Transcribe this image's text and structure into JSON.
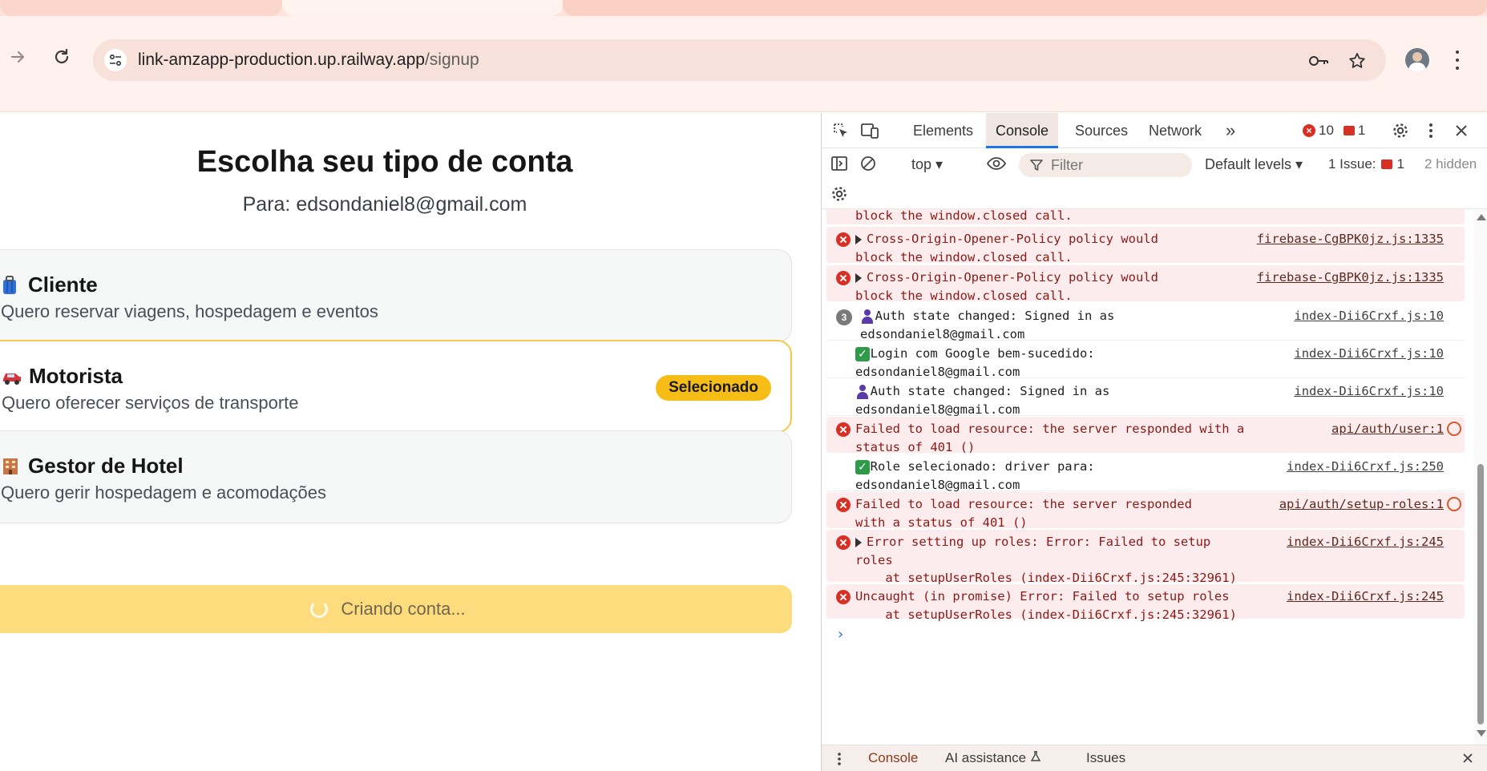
{
  "browser": {
    "url_host": "link-amzapp-production.up.railway.app",
    "url_path": "/signup"
  },
  "page": {
    "title": "Escolha seu tipo de conta",
    "subtitle": "Para: edsondaniel8@gmail.com",
    "cards": [
      {
        "title": "Cliente",
        "description": "Quero reservar viagens, hospedagem e eventos",
        "icon": "luggage-icon"
      },
      {
        "title": "Motorista",
        "description": "Quero oferecer serviços de transporte",
        "icon": "car-icon",
        "badge": "Selecionado"
      },
      {
        "title": "Gestor de Hotel",
        "description": "Quero gerir hospedagem e acomodações",
        "icon": "hotel-icon"
      }
    ],
    "submit_label": "Criando conta..."
  },
  "devtools": {
    "tabs": [
      "Elements",
      "Console",
      "Sources",
      "Network"
    ],
    "active_tab": "Console",
    "more_tabs": "»",
    "error_count": "10",
    "issue_count": "1",
    "context": "top ▾",
    "filter_placeholder": "Filter",
    "levels": "Default levels ▾",
    "issues_label": "1 Issue:",
    "issues_badge": "1",
    "hidden_label": "2 hidden",
    "logs": [
      {
        "type": "error",
        "text": "block the window.closed call.",
        "source": ""
      },
      {
        "type": "error",
        "text": "Cross-Origin-Opener-Policy policy would\nblock the window.closed call.",
        "source": "firebase-CgBPK0jz.js:1335"
      },
      {
        "type": "error",
        "text": "Cross-Origin-Opener-Policy policy would\nblock the window.closed call.",
        "source": "firebase-CgBPK0jz.js:1335"
      },
      {
        "type": "info",
        "repeat": "3",
        "text": "  Auth state changed: Signed in as\nedsondaniel8@gmail.com",
        "source": "index-Dii6Crxf.js:10"
      },
      {
        "type": "info",
        "text": "  Login com Google bem-sucedido:\nedsondaniel8@gmail.com",
        "source": "index-Dii6Crxf.js:10"
      },
      {
        "type": "info",
        "text": "  Auth state changed: Signed in as\nedsondaniel8@gmail.com",
        "source": "index-Dii6Crxf.js:10"
      },
      {
        "type": "error",
        "text": "Failed to load resource: the server responded with a\nstatus of 401 ()",
        "source": "api/auth/user:1"
      },
      {
        "type": "info",
        "text": "  Role selecionado: driver para:\nedsondaniel8@gmail.com",
        "source": "index-Dii6Crxf.js:250"
      },
      {
        "type": "error",
        "text": "Failed to load resource: the server responded\nwith a status of 401 ()",
        "source": "api/auth/setup-roles:1"
      },
      {
        "type": "error",
        "text": "Error setting up roles: Error: Failed to setup\nroles\n    at setupUserRoles (index-Dii6Crxf.js:245:32961)",
        "source": "index-Dii6Crxf.js:245"
      },
      {
        "type": "error",
        "text": "Uncaught (in promise) Error: Failed to setup roles\n    at setupUserRoles (index-Dii6Crxf.js:245:32961)",
        "source": "index-Dii6Crxf.js:245"
      }
    ],
    "prompt": "›",
    "drawer_tabs": [
      "Console",
      "AI assistance",
      "Issues"
    ]
  }
}
